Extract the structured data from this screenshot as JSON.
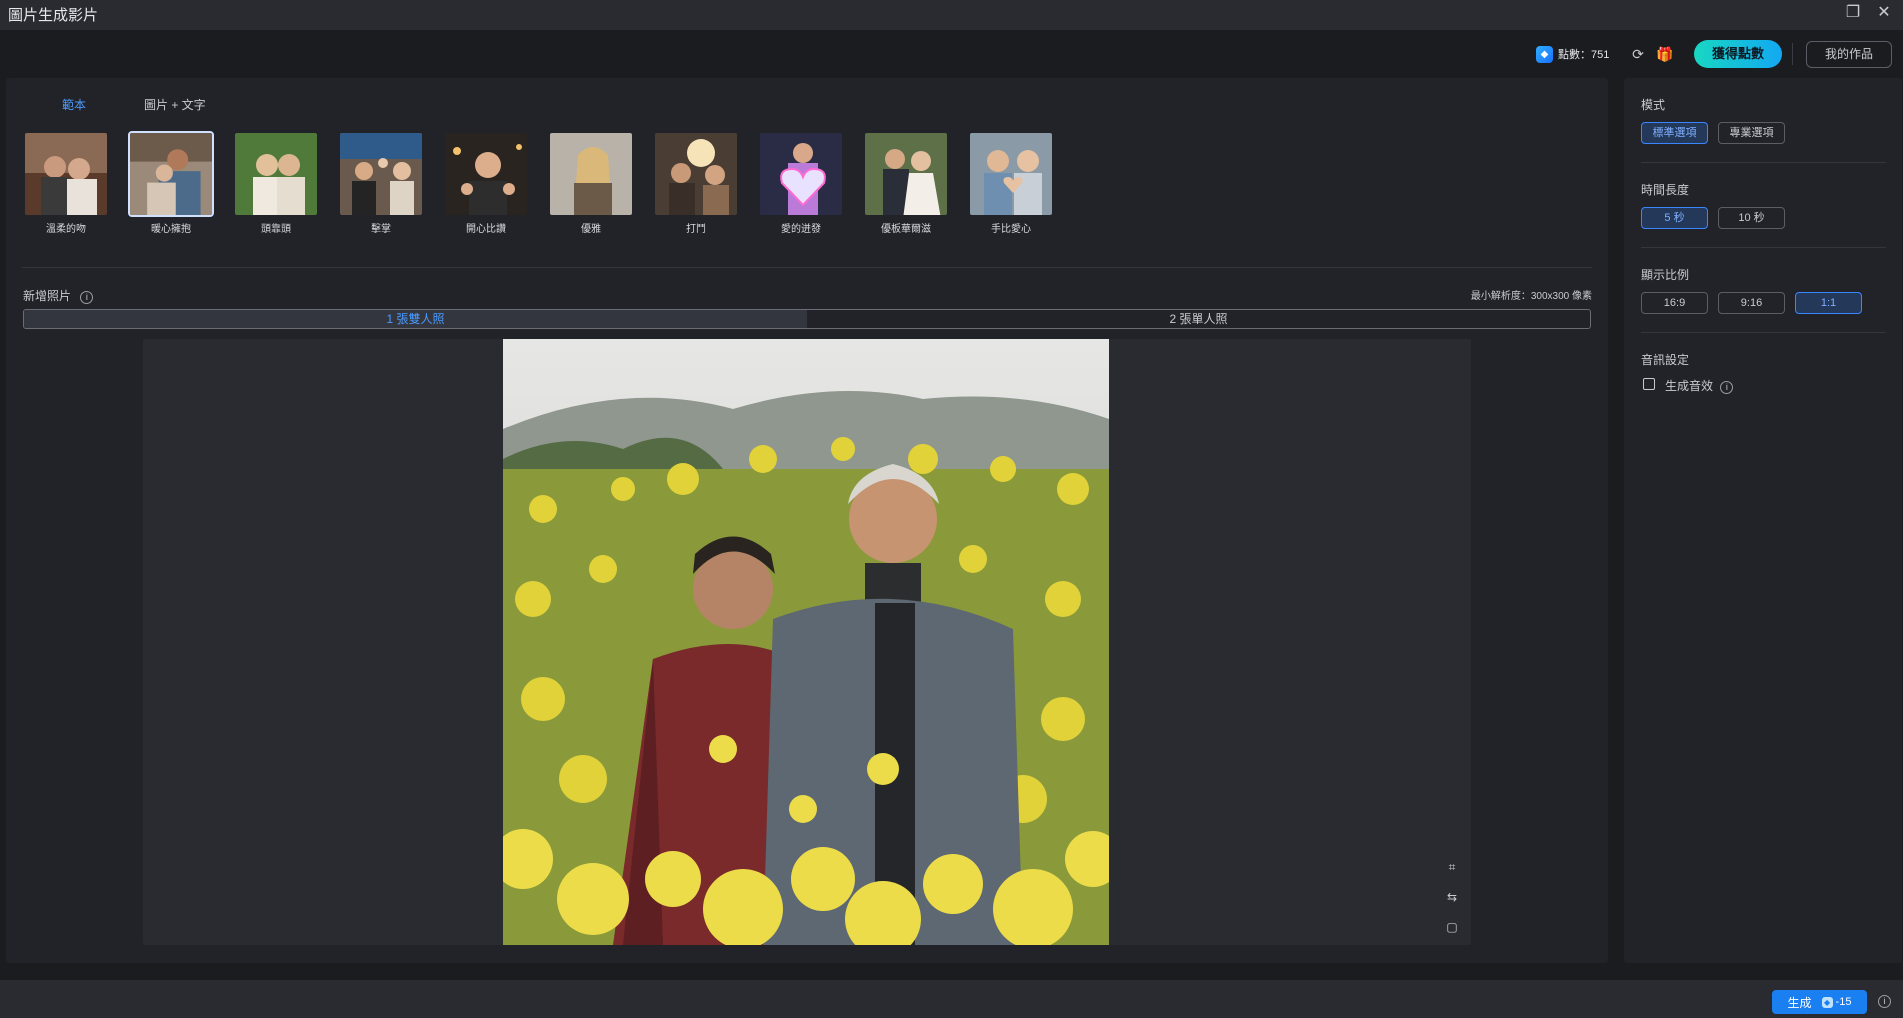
{
  "window": {
    "title": "圖片生成影片"
  },
  "header": {
    "points_label": "點數：751",
    "get_points_label": "獲得點數",
    "my_works_label": "我的作品"
  },
  "tabs": [
    {
      "label": "範本",
      "active": true
    },
    {
      "label": "圖片 + 文字",
      "active": false
    }
  ],
  "templates": [
    {
      "label": "溫柔的吻",
      "selected": false
    },
    {
      "label": "暖心擁抱",
      "selected": true
    },
    {
      "label": "頭靠頭",
      "selected": false
    },
    {
      "label": "擊掌",
      "selected": false
    },
    {
      "label": "開心比讚",
      "selected": false
    },
    {
      "label": "優雅",
      "selected": false
    },
    {
      "label": "打鬥",
      "selected": false
    },
    {
      "label": "愛的迸發",
      "selected": false
    },
    {
      "label": "優板華爾滋",
      "selected": false
    },
    {
      "label": "手比愛心",
      "selected": false
    }
  ],
  "upload": {
    "title": "新增照片",
    "min_resolution": "最小解析度：300x300 像素",
    "options": [
      {
        "label": "1 張雙人照",
        "active": true
      },
      {
        "label": "2 張單人照",
        "active": false
      }
    ]
  },
  "settings": {
    "mode": {
      "title": "模式",
      "options": [
        {
          "label": "標準選項",
          "active": true
        },
        {
          "label": "專業選項",
          "active": false
        }
      ]
    },
    "duration": {
      "title": "時間長度",
      "options": [
        {
          "label": "5 秒",
          "active": true
        },
        {
          "label": "10 秒",
          "active": false
        }
      ]
    },
    "ratio": {
      "title": "顯示比例",
      "options": [
        {
          "label": "16:9",
          "active": false
        },
        {
          "label": "9:16",
          "active": false
        },
        {
          "label": "1:1",
          "active": true
        }
      ]
    },
    "audio": {
      "title": "音訊設定",
      "checkbox_label": "生成音效",
      "checked": false
    }
  },
  "footer": {
    "generate_label": "生成",
    "cost": "-15"
  },
  "colors": {
    "accent": "#3a86ff",
    "teal": "#18d7c2",
    "bg": "#1b1c20",
    "panel": "#222329"
  }
}
